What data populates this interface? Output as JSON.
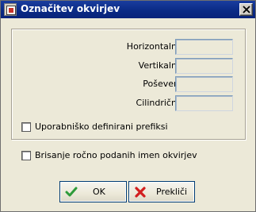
{
  "window": {
    "title": "Označitev okvirjev"
  },
  "fields": [
    {
      "label": "Horizontalni",
      "value": ""
    },
    {
      "label": "Vertikalni",
      "value": ""
    },
    {
      "label": "Poševen",
      "value": ""
    },
    {
      "label": "Cilindrični",
      "value": ""
    }
  ],
  "options": {
    "user_prefixes_label": "Uporabniško definirani prefiksi",
    "user_prefixes_checked": false,
    "delete_names_label": "Brisanje ročno podanih imen okvirjev",
    "delete_names_checked": false
  },
  "buttons": {
    "ok_label": "OK",
    "ok_icon": "checkmark-icon",
    "cancel_label": "Prekliči",
    "cancel_icon": "red-x-icon"
  },
  "colors": {
    "titlebar": "#0b2b86",
    "ok_icon": "#2e9b3a",
    "cancel_icon": "#d21f1f"
  }
}
